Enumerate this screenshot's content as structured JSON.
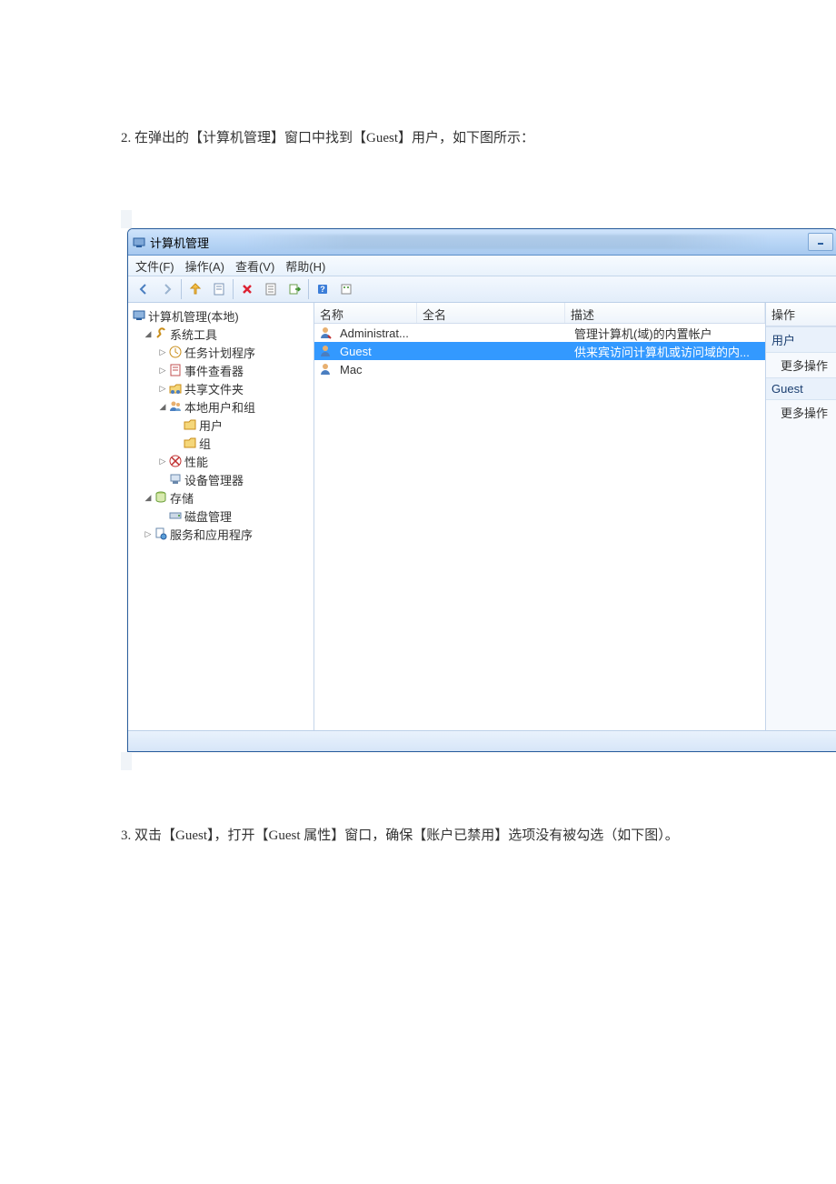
{
  "doc": {
    "step2": "2. 在弹出的【计算机管理】窗口中找到【Guest】用户，如下图所示：",
    "step3": "3. 双击【Guest】，打开【Guest 属性】窗口，确保【账户已禁用】选项没有被勾选（如下图）。"
  },
  "window": {
    "title": "计算机管理",
    "menubar": {
      "file": "文件(F)",
      "action": "操作(A)",
      "view": "查看(V)",
      "help": "帮助(H)"
    },
    "tree": {
      "root": "计算机管理(本地)",
      "tools": "系统工具",
      "task": "任务计划程序",
      "event": "事件查看器",
      "shared": "共享文件夹",
      "local": "本地用户和组",
      "users": "用户",
      "groups": "组",
      "perf": "性能",
      "devmgr": "设备管理器",
      "storage": "存储",
      "diskmgr": "磁盘管理",
      "services": "服务和应用程序"
    },
    "list": {
      "col_name": "名称",
      "col_fullname": "全名",
      "col_desc": "描述",
      "rows": [
        {
          "name": "Administrat...",
          "fullname": "",
          "desc": "管理计算机(域)的内置帐户"
        },
        {
          "name": "Guest",
          "fullname": "",
          "desc": "供来宾访问计算机或访问域的内..."
        },
        {
          "name": "Mac",
          "fullname": "",
          "desc": ""
        }
      ]
    },
    "actions": {
      "header": "操作",
      "section1_title": "用户",
      "section1_item": "更多操作",
      "section2_title": "Guest",
      "section2_item": "更多操作"
    }
  }
}
